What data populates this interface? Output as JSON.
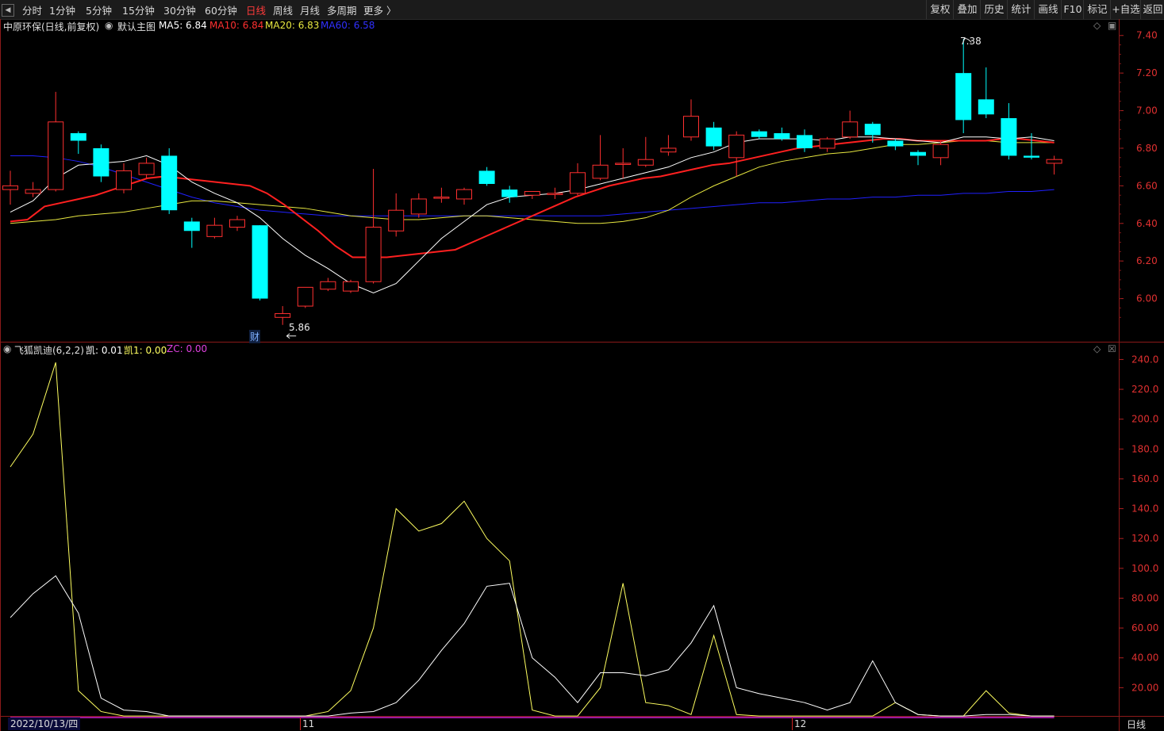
{
  "toolbar": {
    "back_icon": "back-arrow-icon",
    "periods": [
      "分时",
      "1分钟",
      "5分钟",
      "15分钟",
      "30分钟",
      "60分钟",
      "日线",
      "周线",
      "月线",
      "多周期",
      "更多 〉"
    ],
    "active_period": "日线",
    "right_buttons": [
      "复权",
      "叠加",
      "历史",
      "统计",
      "画线",
      "F10",
      "标记",
      "+自选",
      "返回"
    ]
  },
  "main_legend": {
    "stock": "中原环保(日线,前复权)",
    "template": "默认主图",
    "ma5": "MA5: 6.84",
    "ma10": "MA10: 6.84",
    "ma20": "MA20: 6.83",
    "ma60": "MA60: 6.58"
  },
  "sub_legend": {
    "name": "飞狐凯迪(6,2,2)",
    "k": "凯: 0.01",
    "k1": "凯1: 0.00",
    "zc": "ZC: 0.00"
  },
  "annotations": {
    "high": "7.38",
    "low": "5.86",
    "finance_badge": "财"
  },
  "footer": {
    "date": "2022/10/13/四",
    "month_11": "11",
    "month_12": "12",
    "period": "日线"
  },
  "colors": {
    "up": "#ff3030",
    "down": "#00ffff",
    "ma5": "#ffffff",
    "ma10": "#ff2020",
    "ma20": "#e8e840",
    "ma60": "#2020ff",
    "indicator1": "#ffff60",
    "indicator2": "#ffffff",
    "zc": "#d020d0"
  },
  "chart_data": [
    {
      "type": "candlestick",
      "title": "中原环保(日线,前复权)",
      "y_ticks": [
        "7.40",
        "7.20",
        "7.00",
        "6.80",
        "6.60",
        "6.40",
        "6.20",
        "6.00"
      ],
      "ylim": [
        5.8,
        7.42
      ],
      "candles": [
        {
          "o": 6.58,
          "c": 6.6,
          "h": 6.68,
          "l": 6.5
        },
        {
          "o": 6.56,
          "c": 6.58,
          "h": 6.62,
          "l": 6.54
        },
        {
          "o": 6.58,
          "c": 6.94,
          "h": 7.1,
          "l": 6.57
        },
        {
          "o": 6.88,
          "c": 6.84,
          "h": 6.89,
          "l": 6.77
        },
        {
          "o": 6.8,
          "c": 6.65,
          "h": 6.82,
          "l": 6.62
        },
        {
          "o": 6.58,
          "c": 6.68,
          "h": 6.72,
          "l": 6.56
        },
        {
          "o": 6.66,
          "c": 6.72,
          "h": 6.75,
          "l": 6.64
        },
        {
          "o": 6.76,
          "c": 6.47,
          "h": 6.8,
          "l": 6.45
        },
        {
          "o": 6.41,
          "c": 6.36,
          "h": 6.43,
          "l": 6.27
        },
        {
          "o": 6.33,
          "c": 6.39,
          "h": 6.43,
          "l": 6.32
        },
        {
          "o": 6.38,
          "c": 6.42,
          "h": 6.44,
          "l": 6.36
        },
        {
          "o": 6.39,
          "c": 6.0,
          "h": 6.39,
          "l": 5.99
        },
        {
          "o": 5.9,
          "c": 5.92,
          "h": 5.96,
          "l": 5.86
        },
        {
          "o": 5.96,
          "c": 6.06,
          "h": 6.06,
          "l": 5.95
        },
        {
          "o": 6.05,
          "c": 6.09,
          "h": 6.11,
          "l": 6.04
        },
        {
          "o": 6.04,
          "c": 6.09,
          "h": 6.1,
          "l": 6.03
        },
        {
          "o": 6.09,
          "c": 6.38,
          "h": 6.69,
          "l": 6.08
        },
        {
          "o": 6.36,
          "c": 6.47,
          "h": 6.56,
          "l": 6.33
        },
        {
          "o": 6.45,
          "c": 6.53,
          "h": 6.56,
          "l": 6.43
        },
        {
          "o": 6.54,
          "c": 6.54,
          "h": 6.59,
          "l": 6.51
        },
        {
          "o": 6.53,
          "c": 6.58,
          "h": 6.59,
          "l": 6.5
        },
        {
          "o": 6.68,
          "c": 6.61,
          "h": 6.7,
          "l": 6.6
        },
        {
          "o": 6.58,
          "c": 6.54,
          "h": 6.6,
          "l": 6.51
        },
        {
          "o": 6.55,
          "c": 6.57,
          "h": 6.57,
          "l": 6.53
        },
        {
          "o": 6.56,
          "c": 6.56,
          "h": 6.59,
          "l": 6.53
        },
        {
          "o": 6.56,
          "c": 6.67,
          "h": 6.72,
          "l": 6.55
        },
        {
          "o": 6.64,
          "c": 6.71,
          "h": 6.87,
          "l": 6.63
        },
        {
          "o": 6.72,
          "c": 6.72,
          "h": 6.8,
          "l": 6.64
        },
        {
          "o": 6.71,
          "c": 6.74,
          "h": 6.86,
          "l": 6.7
        },
        {
          "o": 6.78,
          "c": 6.8,
          "h": 6.87,
          "l": 6.76
        },
        {
          "o": 6.86,
          "c": 6.97,
          "h": 7.06,
          "l": 6.84
        },
        {
          "o": 6.91,
          "c": 6.81,
          "h": 6.94,
          "l": 6.79
        },
        {
          "o": 6.75,
          "c": 6.87,
          "h": 6.89,
          "l": 6.65
        },
        {
          "o": 6.89,
          "c": 6.86,
          "h": 6.9,
          "l": 6.85
        },
        {
          "o": 6.88,
          "c": 6.85,
          "h": 6.91,
          "l": 6.84
        },
        {
          "o": 6.87,
          "c": 6.8,
          "h": 6.9,
          "l": 6.78
        },
        {
          "o": 6.8,
          "c": 6.85,
          "h": 6.86,
          "l": 6.78
        },
        {
          "o": 6.86,
          "c": 6.94,
          "h": 7.0,
          "l": 6.85
        },
        {
          "o": 6.93,
          "c": 6.87,
          "h": 6.94,
          "l": 6.83
        },
        {
          "o": 6.84,
          "c": 6.81,
          "h": 6.85,
          "l": 6.79
        },
        {
          "o": 6.78,
          "c": 6.76,
          "h": 6.79,
          "l": 6.71
        },
        {
          "o": 6.75,
          "c": 6.82,
          "h": 6.84,
          "l": 6.71
        },
        {
          "o": 7.2,
          "c": 6.95,
          "h": 7.38,
          "l": 6.88
        },
        {
          "o": 7.06,
          "c": 6.98,
          "h": 7.23,
          "l": 6.96
        },
        {
          "o": 6.96,
          "c": 6.76,
          "h": 7.04,
          "l": 6.74
        },
        {
          "o": 6.76,
          "c": 6.75,
          "h": 6.88,
          "l": 6.74
        },
        {
          "o": 6.72,
          "c": 6.74,
          "h": 6.76,
          "l": 6.66
        }
      ],
      "ma5": [
        6.46,
        6.52,
        6.64,
        6.71,
        6.72,
        6.73,
        6.76,
        6.71,
        6.62,
        6.56,
        6.51,
        6.43,
        6.32,
        6.23,
        6.16,
        6.08,
        6.03,
        6.08,
        6.2,
        6.32,
        6.41,
        6.5,
        6.54,
        6.55,
        6.56,
        6.58,
        6.61,
        6.64,
        6.67,
        6.7,
        6.75,
        6.78,
        6.83,
        6.85,
        6.85,
        6.85,
        6.84,
        6.86,
        6.86,
        6.85,
        6.84,
        6.83,
        6.86,
        6.86,
        6.85,
        6.86,
        6.84
      ],
      "ma10": [
        6.41,
        6.42,
        6.49,
        6.51,
        6.53,
        6.55,
        6.58,
        6.61,
        6.64,
        6.65,
        6.64,
        6.63,
        6.62,
        6.61,
        6.6,
        6.56,
        6.5,
        6.43,
        6.36,
        6.28,
        6.22,
        6.22,
        6.22,
        6.23,
        6.24,
        6.25,
        6.26,
        6.3,
        6.34,
        6.38,
        6.42,
        6.46,
        6.5,
        6.54,
        6.57,
        6.6,
        6.62,
        6.64,
        6.65,
        6.67,
        6.69,
        6.71,
        6.72,
        6.74,
        6.76,
        6.78,
        6.8,
        6.81,
        6.82,
        6.83,
        6.84,
        6.85,
        6.85,
        6.84,
        6.84,
        6.84,
        6.84,
        6.84,
        6.85,
        6.85,
        6.84,
        6.83
      ],
      "ma20": [
        6.4,
        6.41,
        6.42,
        6.44,
        6.45,
        6.46,
        6.48,
        6.5,
        6.52,
        6.52,
        6.51,
        6.5,
        6.49,
        6.48,
        6.46,
        6.44,
        6.43,
        6.42,
        6.42,
        6.43,
        6.44,
        6.44,
        6.43,
        6.42,
        6.41,
        6.4,
        6.4,
        6.41,
        6.43,
        6.47,
        6.54,
        6.6,
        6.65,
        6.7,
        6.73,
        6.75,
        6.77,
        6.78,
        6.8,
        6.82,
        6.82,
        6.83,
        6.84,
        6.84,
        6.83,
        6.83,
        6.83
      ],
      "ma60": [
        6.76,
        6.76,
        6.75,
        6.73,
        6.7,
        6.66,
        6.62,
        6.58,
        6.54,
        6.51,
        6.49,
        6.47,
        6.46,
        6.45,
        6.44,
        6.44,
        6.44,
        6.44,
        6.44,
        6.44,
        6.44,
        6.44,
        6.44,
        6.44,
        6.44,
        6.44,
        6.44,
        6.45,
        6.46,
        6.47,
        6.48,
        6.49,
        6.5,
        6.51,
        6.51,
        6.52,
        6.53,
        6.53,
        6.54,
        6.54,
        6.55,
        6.55,
        6.56,
        6.56,
        6.57,
        6.57,
        6.58
      ]
    },
    {
      "type": "line",
      "title": "飞狐凯迪(6,2,2)",
      "y_ticks": [
        "240.0",
        "220.0",
        "200.0",
        "180.0",
        "160.0",
        "140.0",
        "120.0",
        "100.0",
        "80.00",
        "60.00",
        "40.00",
        "20.00"
      ],
      "ylim": [
        0,
        245
      ],
      "series": [
        {
          "name": "凯",
          "values": [
            168,
            190,
            238,
            18,
            4,
            1,
            1,
            1,
            1,
            1,
            1,
            1,
            1,
            1,
            4,
            18,
            60,
            140,
            125,
            130,
            145,
            120,
            105,
            5,
            1,
            1,
            20,
            90,
            10,
            8,
            2,
            55,
            2,
            1,
            1,
            1,
            1,
            1,
            1,
            10,
            2,
            1,
            1,
            18,
            3,
            1,
            1
          ]
        },
        {
          "name": "凯1",
          "values": [
            67,
            83,
            95,
            70,
            13,
            5,
            4,
            1,
            1,
            1,
            1,
            1,
            1,
            1,
            1,
            3,
            4,
            10,
            25,
            45,
            63,
            88,
            90,
            40,
            27,
            10,
            30,
            30,
            28,
            32,
            50,
            75,
            20,
            16,
            13,
            10,
            5,
            10,
            38,
            10,
            2,
            1,
            1,
            2,
            2,
            1,
            1
          ]
        },
        {
          "name": "ZC",
          "values": [
            0,
            0,
            0,
            0,
            0,
            0,
            0,
            0,
            0,
            0,
            0,
            0,
            0,
            0,
            0,
            0,
            0,
            0,
            0,
            0,
            0,
            0,
            0,
            0,
            0,
            0,
            0,
            0,
            0,
            0,
            0,
            0,
            0,
            0,
            0,
            0,
            0,
            0,
            0,
            0,
            0,
            0,
            0,
            0,
            0,
            0,
            0
          ]
        }
      ]
    }
  ]
}
